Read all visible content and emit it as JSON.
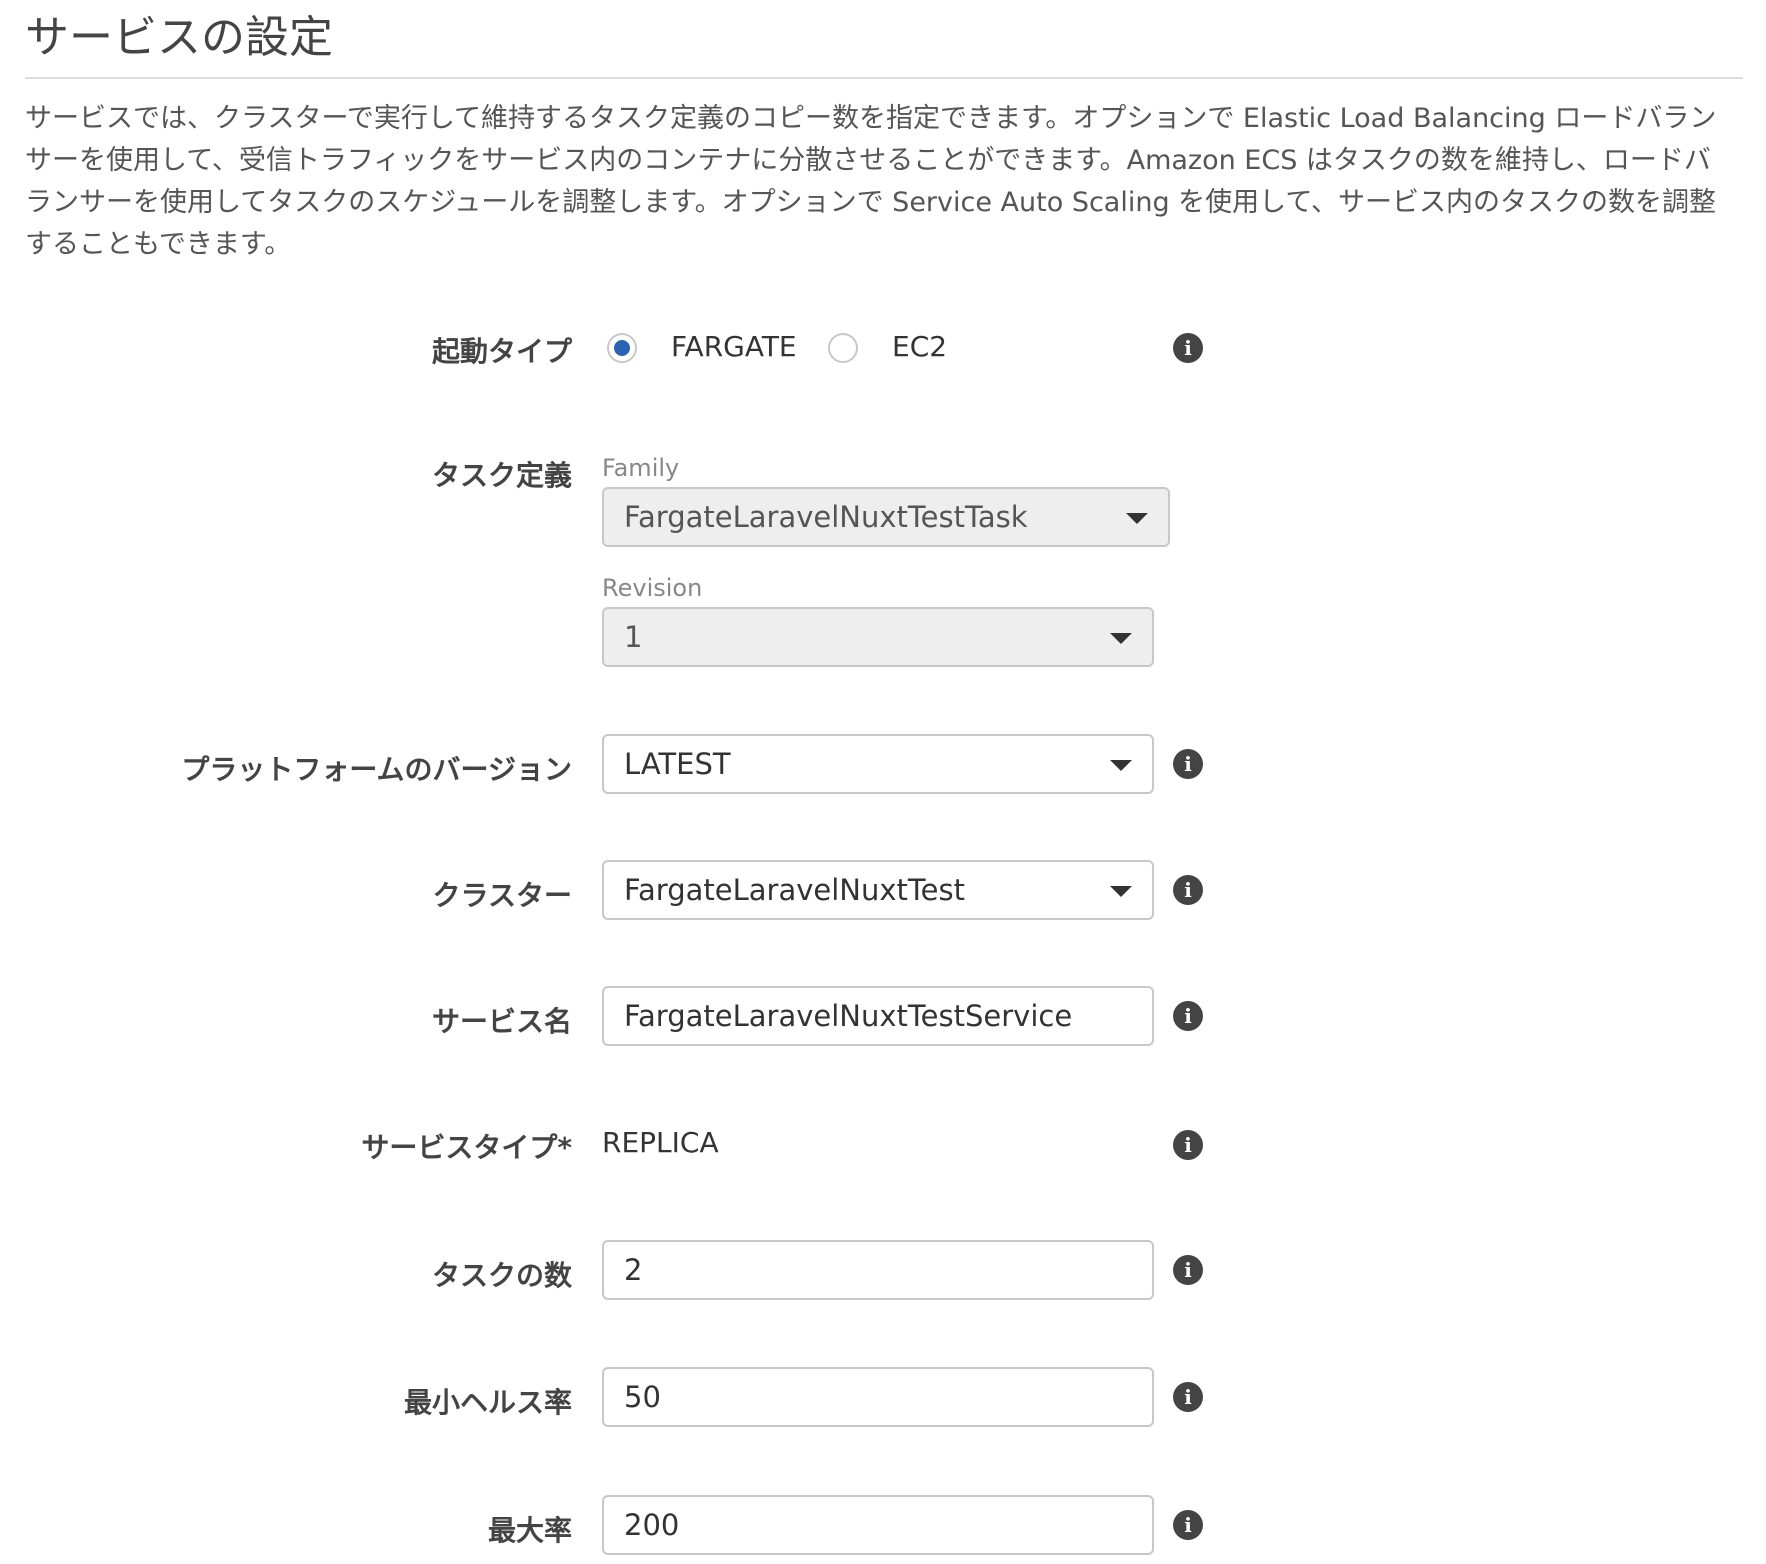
{
  "page": {
    "title": "サービスの設定",
    "description": "サービスでは、クラスターで実行して維持するタスク定義のコピー数を指定できます。オプションで Elastic Load Balancing ロードバランサーを使用して、受信トラフィックをサービス内のコンテナに分散させることができます。Amazon ECS はタスクの数を維持し、ロードバランサーを使用してタスクのスケジュールを調整します。オプションで Service Auto Scaling を使用して、サービス内のタスクの数を調整することもできます。"
  },
  "launch_type": {
    "label": "起動タイプ",
    "options": [
      {
        "label": "FARGATE",
        "selected": true
      },
      {
        "label": "EC2",
        "selected": false
      }
    ]
  },
  "task_definition": {
    "label": "タスク定義",
    "family_label": "Family",
    "family_value": "FargateLaravelNuxtTestTask",
    "revision_label": "Revision",
    "revision_value": "1"
  },
  "platform_version": {
    "label": "プラットフォームのバージョン",
    "value": "LATEST"
  },
  "cluster": {
    "label": "クラスター",
    "value": "FargateLaravelNuxtTest"
  },
  "service_name": {
    "label": "サービス名",
    "value": "FargateLaravelNuxtTestService"
  },
  "service_type": {
    "label": "サービスタイプ*",
    "value": "REPLICA"
  },
  "number_of_tasks": {
    "label": "タスクの数",
    "value": "2"
  },
  "min_healthy_percent": {
    "label": "最小ヘルス率",
    "value": "50"
  },
  "max_percent": {
    "label": "最大率",
    "value": "200"
  },
  "icons": {
    "info": "info-icon",
    "dropdown": "chevron-down-icon"
  },
  "colors": {
    "radio_selected": "#2a63b6",
    "disabled_field": "#eeeeee",
    "field_border": "#c8c8c8",
    "info_icon": "#444444"
  }
}
